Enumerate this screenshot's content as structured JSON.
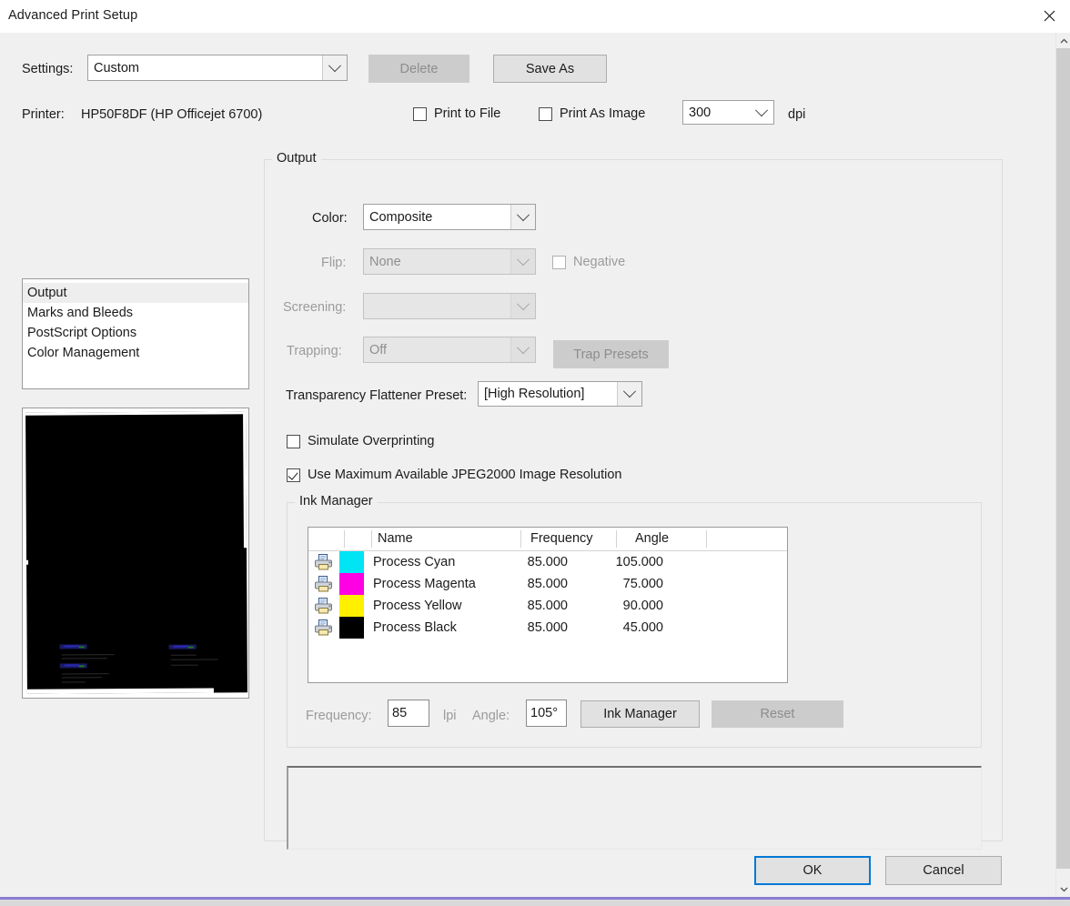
{
  "window": {
    "title": "Advanced Print Setup",
    "close_icon": "close-icon"
  },
  "header": {
    "settings_label": "Settings:",
    "settings_value": "Custom",
    "delete_label": "Delete",
    "save_as_label": "Save As",
    "printer_label": "Printer:",
    "printer_value": "HP50F8DF (HP Officejet 6700)",
    "print_to_file_label": "Print to File",
    "print_to_file_checked": false,
    "print_as_image_label": "Print As Image",
    "print_as_image_checked": false,
    "dpi_value": "300",
    "dpi_label": "dpi"
  },
  "sidebar": {
    "items": [
      {
        "label": "Output",
        "selected": true
      },
      {
        "label": "Marks and Bleeds",
        "selected": false
      },
      {
        "label": "PostScript Options",
        "selected": false
      },
      {
        "label": "Color Management",
        "selected": false
      }
    ]
  },
  "output": {
    "group_title": "Output",
    "color_label": "Color:",
    "color_value": "Composite",
    "flip_label": "Flip:",
    "flip_value": "None",
    "flip_disabled": true,
    "negative_label": "Negative",
    "negative_checked": false,
    "negative_disabled": true,
    "screening_label": "Screening:",
    "screening_value": "",
    "screening_disabled": true,
    "trapping_label": "Trapping:",
    "trapping_value": "Off",
    "trapping_disabled": true,
    "trap_presets_label": "Trap Presets",
    "trap_presets_disabled": true,
    "flattener_label": "Transparency Flattener Preset:",
    "flattener_value": "[High Resolution]",
    "simulate_overprinting_label": "Simulate Overprinting",
    "simulate_overprinting_checked": false,
    "jpeg2000_label": "Use Maximum Available JPEG2000 Image Resolution",
    "jpeg2000_checked": true
  },
  "ink_manager": {
    "group_title": "Ink Manager",
    "columns": [
      "",
      "",
      "Name",
      "Frequency",
      "Angle",
      ""
    ],
    "rows": [
      {
        "icon": "printer-icon",
        "color": "#00e5f5",
        "name": "Process Cyan",
        "frequency": "85.000",
        "angle": "105.000"
      },
      {
        "icon": "printer-icon",
        "color": "#ff00e5",
        "name": "Process Magenta",
        "frequency": "85.000",
        "angle": "75.000"
      },
      {
        "icon": "printer-icon",
        "color": "#fff000",
        "name": "Process Yellow",
        "frequency": "85.000",
        "angle": "90.000"
      },
      {
        "icon": "printer-icon",
        "color": "#000000",
        "name": "Process Black",
        "frequency": "85.000",
        "angle": "45.000"
      }
    ],
    "frequency_label": "Frequency:",
    "frequency_value": "85",
    "lpi_label": "lpi",
    "angle_label": "Angle:",
    "angle_value": "105°",
    "ink_manager_button": "Ink Manager",
    "reset_button": "Reset",
    "reset_disabled": true
  },
  "footer": {
    "ok_label": "OK",
    "cancel_label": "Cancel"
  },
  "colors": {
    "accent": "#0078d7",
    "dialog_bg": "#f0f0f0",
    "text": "#1b1b1b",
    "disabled_text": "#9b9b9b",
    "bottom_rule": "#6a5acd"
  }
}
